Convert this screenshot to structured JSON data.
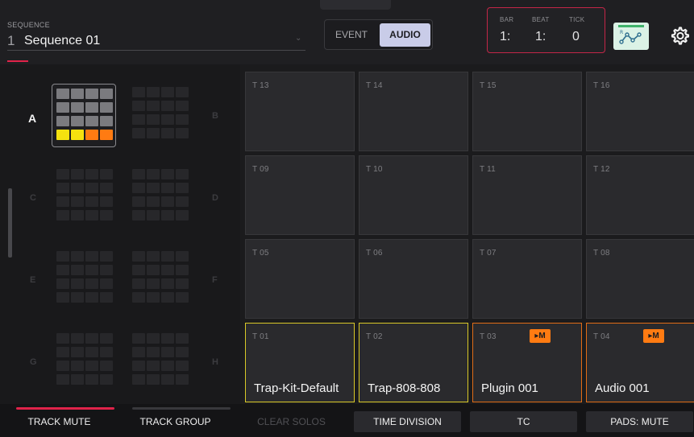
{
  "header": {
    "sequence_caption": "SEQUENCE",
    "sequence_number": "1",
    "sequence_name": "Sequence 01",
    "mode_event_label": "EVENT",
    "mode_audio_label": "AUDIO",
    "mode_selected": "AUDIO",
    "position": {
      "bar_caption": "BAR",
      "beat_caption": "BEAT",
      "tick_caption": "TICK",
      "bar_value": "1:",
      "beat_value": "1:",
      "tick_value": "0"
    },
    "automation_icon": "automation-icon",
    "settings_icon": "gear-icon"
  },
  "banks": {
    "active_label": "A",
    "dim_labels": [
      "B",
      "C",
      "D",
      "E",
      "F",
      "G",
      "H"
    ],
    "active_cell_colors": [
      "#7b7b7f",
      "#7b7b7f",
      "#7b7b7f",
      "#7b7b7f",
      "#7b7b7f",
      "#7b7b7f",
      "#7b7b7f",
      "#7b7b7f",
      "#7b7b7f",
      "#7b7b7f",
      "#7b7b7f",
      "#7b7b7f",
      "#f5e10f",
      "#f5e10f",
      "#ff7b12",
      "#ff7b12"
    ]
  },
  "pads": [
    {
      "id": "T 13",
      "name": "",
      "state": "empty"
    },
    {
      "id": "T 14",
      "name": "",
      "state": "empty"
    },
    {
      "id": "T 15",
      "name": "",
      "state": "empty"
    },
    {
      "id": "T 16",
      "name": "",
      "state": "empty"
    },
    {
      "id": "T 09",
      "name": "",
      "state": "empty"
    },
    {
      "id": "T 10",
      "name": "",
      "state": "empty"
    },
    {
      "id": "T 11",
      "name": "",
      "state": "empty"
    },
    {
      "id": "T 12",
      "name": "",
      "state": "empty"
    },
    {
      "id": "T 05",
      "name": "",
      "state": "empty"
    },
    {
      "id": "T 06",
      "name": "",
      "state": "empty"
    },
    {
      "id": "T 07",
      "name": "",
      "state": "empty"
    },
    {
      "id": "T 08",
      "name": "",
      "state": "empty"
    },
    {
      "id": "T 01",
      "name": "Trap-Kit-Default",
      "state": "yellow"
    },
    {
      "id": "T 02",
      "name": "Trap-808-808",
      "state": "yellow"
    },
    {
      "id": "T 03",
      "name": "Plugin 001",
      "state": "orange",
      "badge": "▸M"
    },
    {
      "id": "T 04",
      "name": "Audio 001",
      "state": "orange",
      "badge": "▸M"
    }
  ],
  "footer": [
    {
      "label": "TRACK MUTE",
      "style": "tab",
      "active": true
    },
    {
      "label": "TRACK GROUP",
      "style": "tab",
      "active": false
    },
    {
      "label": "CLEAR SOLOS",
      "style": "disabled",
      "active": false
    },
    {
      "label": "TIME DIVISION",
      "style": "filled",
      "active": false
    },
    {
      "label": "TC",
      "style": "filled",
      "active": false
    },
    {
      "label": "PADS: MUTE",
      "style": "filled",
      "active": false
    }
  ],
  "colors": {
    "accent_red": "#e0234a",
    "audio_toggle": "#c9cce8",
    "pad_yellow": "#d9c928",
    "pad_orange": "#e06c16",
    "badge_orange": "#ff7b12",
    "automation_bg": "#dbf2e6"
  }
}
